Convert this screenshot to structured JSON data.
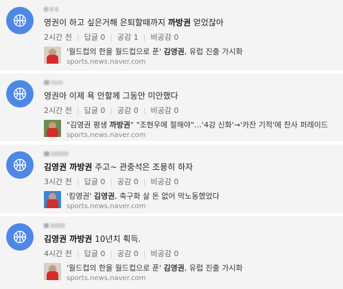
{
  "comments": [
    {
      "text_before": "영권이 하고 싶은거해 은퇴할때까지 ",
      "text_bold": "까방권",
      "text_after": " 얻었잖아",
      "time": "2시간 전",
      "reply_label": "답글",
      "reply_count": "0",
      "like_label": "공감",
      "like_count": "1",
      "dislike_label": "비공감",
      "dislike_count": "0",
      "news_before": "'월드컵의 한을 월드컵으로 푼' ",
      "news_bold": "김영권",
      "news_after": ", 유럽 진출 가시화",
      "news_source": "sports.news.naver.com"
    },
    {
      "text_before": "영권아 이제 욕 안할께 그동안 미안했다",
      "text_bold": "",
      "text_after": "",
      "time": "2시간 전",
      "reply_label": "답글",
      "reply_count": "0",
      "like_label": "공감",
      "like_count": "0",
      "dislike_label": "비공감",
      "dislike_count": "0",
      "news_before": "\"김영권 평생 ",
      "news_bold": "까방권",
      "news_after": "\" \"조현우에 절해야\"…'4강 신화'→'카잔 기적'에 찬사 퍼레이드",
      "news_source": "sports.news.naver.com"
    },
    {
      "text_before": "",
      "text_bold": "김영권 까방권",
      "text_after": " 주고~ 관중석은 조용히 하자",
      "time": "3시간 전",
      "reply_label": "답글",
      "reply_count": "0",
      "like_label": "공감",
      "like_count": "0",
      "dislike_label": "비공감",
      "dislike_count": "0",
      "news_before": "'킹영권' ",
      "news_bold": "김영권",
      "news_after": ", 축구화 살 돈 없어 막노동했었다",
      "news_source": "sports.news.naver.com"
    },
    {
      "text_before": "",
      "text_bold": "김영권 까방권",
      "text_after": " 10년치 획득.",
      "time": "4시간 전",
      "reply_label": "답글",
      "reply_count": "0",
      "like_label": "공감",
      "like_count": "0",
      "dislike_label": "비공감",
      "dislike_count": "0",
      "news_before": "'월드컵의 한을 월드컵으로 푼' ",
      "news_bold": "김영권",
      "news_after": ", 유럽 진출 가시화",
      "news_source": "sports.news.naver.com"
    }
  ],
  "icons": {
    "avatar": "basketball-icon"
  },
  "colors": {
    "avatar_bg": "#4d88e6",
    "card_bg": "#f4f4f4"
  }
}
